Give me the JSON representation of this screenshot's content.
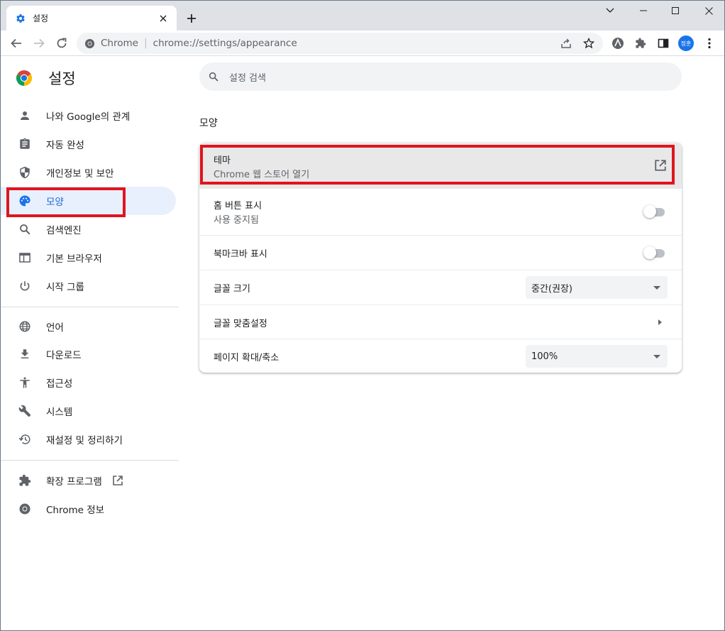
{
  "tab": {
    "title": "설정",
    "new_tab_symbol": "+"
  },
  "toolbar": {
    "site_label": "Chrome",
    "separator": "|",
    "url": "chrome://settings/appearance",
    "avatar_text": "정훈"
  },
  "sidebar": {
    "title": "설정",
    "items": [
      {
        "label": "나와 Google의 관계",
        "icon": "person-icon"
      },
      {
        "label": "자동 완성",
        "icon": "clipboard-icon"
      },
      {
        "label": "개인정보 및 보안",
        "icon": "shield-icon"
      },
      {
        "label": "모양",
        "icon": "palette-icon",
        "active": true
      },
      {
        "label": "검색엔진",
        "icon": "search-icon"
      },
      {
        "label": "기본 브라우저",
        "icon": "browser-window-icon"
      },
      {
        "label": "시작 그룹",
        "icon": "power-icon"
      },
      {
        "label": "언어",
        "icon": "globe-icon"
      },
      {
        "label": "다운로드",
        "icon": "download-icon"
      },
      {
        "label": "접근성",
        "icon": "accessibility-icon"
      },
      {
        "label": "시스템",
        "icon": "wrench-icon"
      },
      {
        "label": "재설정 및 정리하기",
        "icon": "restore-icon"
      },
      {
        "label": "확장 프로그램",
        "icon": "puzzle-icon"
      },
      {
        "label": "Chrome 정보",
        "icon": "chrome-icon"
      }
    ]
  },
  "search": {
    "placeholder": "설정 검색"
  },
  "section": {
    "title": "모양"
  },
  "settings": {
    "theme": {
      "title": "테마",
      "subtitle": "Chrome 웹 스토어 열기"
    },
    "home_button": {
      "title": "홈 버튼 표시",
      "subtitle": "사용 중지됨",
      "enabled": false
    },
    "bookmarks_bar": {
      "title": "북마크바 표시",
      "enabled": false
    },
    "font_size": {
      "title": "글꼴 크기",
      "value": "중간(권장)"
    },
    "custom_fonts": {
      "title": "글꼴 맞춤설정"
    },
    "page_zoom": {
      "title": "페이지 확대/축소",
      "value": "100%"
    }
  },
  "colors": {
    "accent": "#1a73e8",
    "highlight": "#e0141e",
    "active_bg": "#e8f0fe"
  }
}
